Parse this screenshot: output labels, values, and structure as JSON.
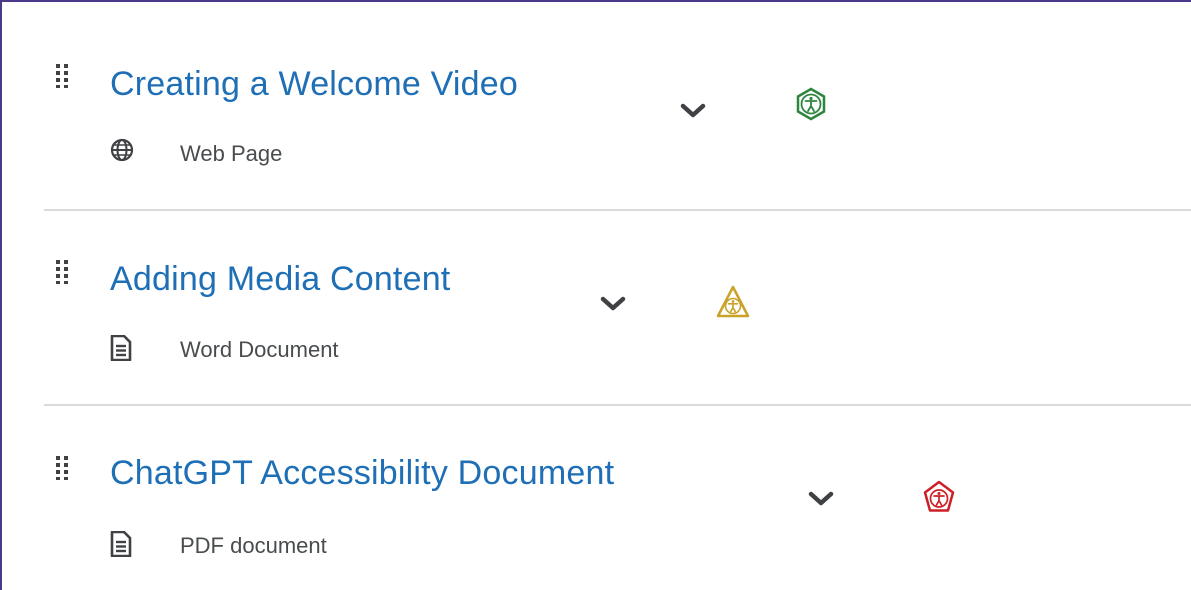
{
  "items": [
    {
      "title": "Creating a Welcome Video",
      "type_label": "Web Page",
      "type_icon": "globe-icon",
      "accessibility_status": "accessible",
      "accessibility_color": "#2e8540"
    },
    {
      "title": "Adding Media Content",
      "type_label": "Word Document",
      "type_icon": "document-icon",
      "accessibility_status": "warning",
      "accessibility_color": "#c9a227"
    },
    {
      "title": "ChatGPT Accessibility Document",
      "type_label": "PDF document",
      "type_icon": "document-icon",
      "accessibility_status": "error",
      "accessibility_color": "#cd2026"
    }
  ],
  "colors": {
    "link": "#1e6fb5",
    "text": "#494c4e",
    "divider": "#d9dadc",
    "frame": "#4b3a8c"
  }
}
